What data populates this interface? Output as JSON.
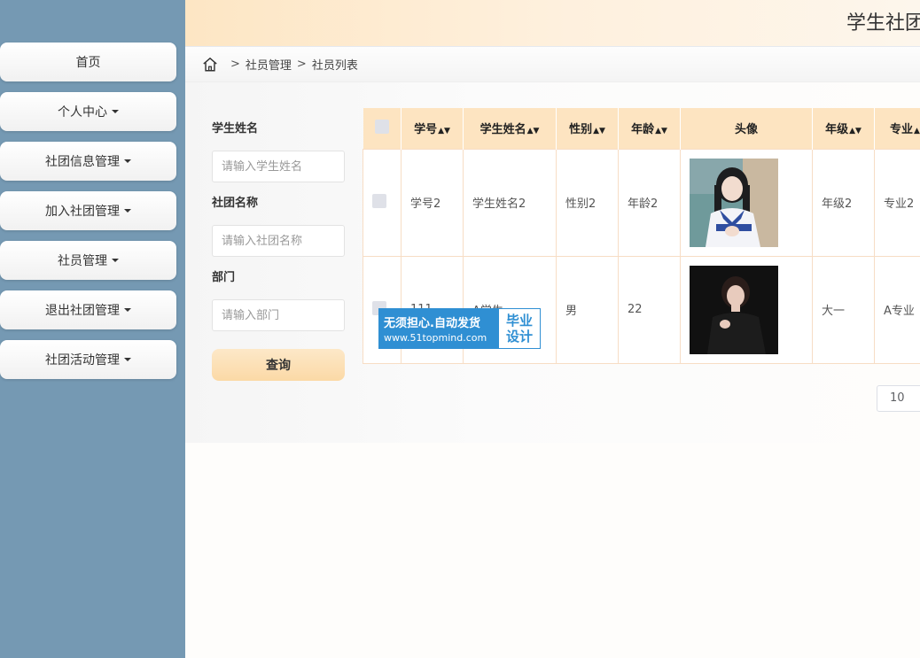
{
  "header": {
    "title": "学生社团"
  },
  "sidebar": {
    "items": [
      {
        "label": "首页",
        "dropdown": false
      },
      {
        "label": "个人中心",
        "dropdown": true
      },
      {
        "label": "社团信息管理",
        "dropdown": true
      },
      {
        "label": "加入社团管理",
        "dropdown": true
      },
      {
        "label": "社员管理",
        "dropdown": true
      },
      {
        "label": "退出社团管理",
        "dropdown": true
      },
      {
        "label": "社团活动管理",
        "dropdown": true
      }
    ]
  },
  "breadcrumb": {
    "level1": "社员管理",
    "level2": "社员列表",
    "separator": ">"
  },
  "search": {
    "student_name_label": "学生姓名",
    "student_name_placeholder": "请输入学生姓名",
    "club_name_label": "社团名称",
    "club_name_placeholder": "请输入社团名称",
    "department_label": "部门",
    "department_placeholder": "请输入部门",
    "query_button": "查询"
  },
  "table": {
    "headers": {
      "student_no": "学号",
      "student_name": "学生姓名",
      "gender": "性别",
      "age": "年龄",
      "avatar": "头像",
      "grade": "年级",
      "major": "专业"
    },
    "rows": [
      {
        "student_no": "学号2",
        "student_name": "学生姓名2",
        "gender": "性别2",
        "age": "年龄2",
        "grade": "年级2",
        "major": "专业2"
      },
      {
        "student_no": "111",
        "student_name": "A学生",
        "gender": "男",
        "age": "22",
        "grade": "大一",
        "major": "A专业"
      }
    ]
  },
  "watermark": {
    "line1": "无须担心.自动发货",
    "line2": "www.51topmind.com",
    "right_top": "毕业",
    "right_bottom": "设计"
  },
  "pagination": {
    "page_size": "10"
  },
  "colors": {
    "sidebar": "#7599b3",
    "header": "#fde6c4",
    "table_header": "#fde4c1",
    "query_button": "#fbd9a6"
  }
}
